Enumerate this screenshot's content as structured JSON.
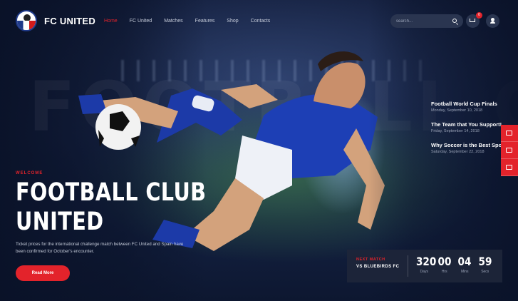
{
  "header": {
    "brand": "FC UNITED",
    "nav": [
      {
        "label": "Home",
        "active": true
      },
      {
        "label": "FC United",
        "active": false
      },
      {
        "label": "Matches",
        "active": false
      },
      {
        "label": "Features",
        "active": false
      },
      {
        "label": "Shop",
        "active": false
      },
      {
        "label": "Contacts",
        "active": false
      }
    ],
    "search": {
      "placeholder": "search..."
    },
    "cart_count": "0"
  },
  "hero": {
    "watermark": "FOOTBALL CLUB",
    "welcome": "WELCOME",
    "title_line1": "FOOTBALL CLUB",
    "title_line2": "UNITED",
    "description": "Ticket prices for the international challenge match between FC United and Spain have been confirmed for October's encounter.",
    "button": "Read More"
  },
  "news": [
    {
      "title": "Football World Cup Finals",
      "date": "Monday, September 10, 2018"
    },
    {
      "title": "The Team that You Support!",
      "date": "Friday, September 14, 2018"
    },
    {
      "title": "Why Soccer is the Best Sport",
      "date": "Saturday, September 22, 2018"
    }
  ],
  "next_match": {
    "label": "NEXT MATCH",
    "opponent": "VS BLUEBIRDS FC",
    "countdown": [
      {
        "value": "320",
        "unit": "Days"
      },
      {
        "value": "00",
        "unit": "Hrs"
      },
      {
        "value": "04",
        "unit": "Mins"
      },
      {
        "value": "59",
        "unit": "Secs"
      }
    ]
  },
  "colors": {
    "accent": "#e3232b",
    "background": "#0f1a36",
    "jersey": "#1d3fb5"
  },
  "icons": [
    "search-icon",
    "cart-icon",
    "user-icon",
    "cart-side-icon",
    "wallet-icon",
    "card-icon"
  ]
}
